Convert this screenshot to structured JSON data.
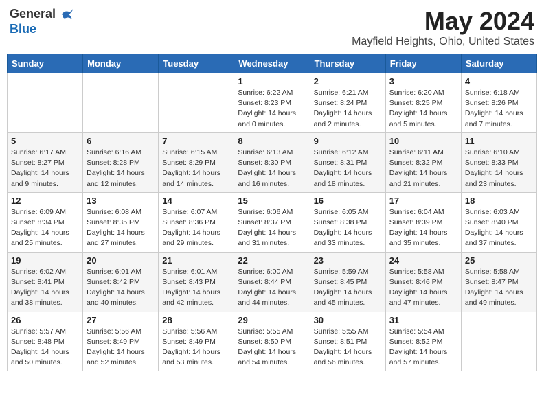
{
  "header": {
    "logo_line1": "General",
    "logo_line2": "Blue",
    "main_title": "May 2024",
    "subtitle": "Mayfield Heights, Ohio, United States"
  },
  "calendar": {
    "weekdays": [
      "Sunday",
      "Monday",
      "Tuesday",
      "Wednesday",
      "Thursday",
      "Friday",
      "Saturday"
    ],
    "weeks": [
      [
        {
          "day": "",
          "info": ""
        },
        {
          "day": "",
          "info": ""
        },
        {
          "day": "",
          "info": ""
        },
        {
          "day": "1",
          "info": "Sunrise: 6:22 AM\nSunset: 8:23 PM\nDaylight: 14 hours and 0 minutes."
        },
        {
          "day": "2",
          "info": "Sunrise: 6:21 AM\nSunset: 8:24 PM\nDaylight: 14 hours and 2 minutes."
        },
        {
          "day": "3",
          "info": "Sunrise: 6:20 AM\nSunset: 8:25 PM\nDaylight: 14 hours and 5 minutes."
        },
        {
          "day": "4",
          "info": "Sunrise: 6:18 AM\nSunset: 8:26 PM\nDaylight: 14 hours and 7 minutes."
        }
      ],
      [
        {
          "day": "5",
          "info": "Sunrise: 6:17 AM\nSunset: 8:27 PM\nDaylight: 14 hours and 9 minutes."
        },
        {
          "day": "6",
          "info": "Sunrise: 6:16 AM\nSunset: 8:28 PM\nDaylight: 14 hours and 12 minutes."
        },
        {
          "day": "7",
          "info": "Sunrise: 6:15 AM\nSunset: 8:29 PM\nDaylight: 14 hours and 14 minutes."
        },
        {
          "day": "8",
          "info": "Sunrise: 6:13 AM\nSunset: 8:30 PM\nDaylight: 14 hours and 16 minutes."
        },
        {
          "day": "9",
          "info": "Sunrise: 6:12 AM\nSunset: 8:31 PM\nDaylight: 14 hours and 18 minutes."
        },
        {
          "day": "10",
          "info": "Sunrise: 6:11 AM\nSunset: 8:32 PM\nDaylight: 14 hours and 21 minutes."
        },
        {
          "day": "11",
          "info": "Sunrise: 6:10 AM\nSunset: 8:33 PM\nDaylight: 14 hours and 23 minutes."
        }
      ],
      [
        {
          "day": "12",
          "info": "Sunrise: 6:09 AM\nSunset: 8:34 PM\nDaylight: 14 hours and 25 minutes."
        },
        {
          "day": "13",
          "info": "Sunrise: 6:08 AM\nSunset: 8:35 PM\nDaylight: 14 hours and 27 minutes."
        },
        {
          "day": "14",
          "info": "Sunrise: 6:07 AM\nSunset: 8:36 PM\nDaylight: 14 hours and 29 minutes."
        },
        {
          "day": "15",
          "info": "Sunrise: 6:06 AM\nSunset: 8:37 PM\nDaylight: 14 hours and 31 minutes."
        },
        {
          "day": "16",
          "info": "Sunrise: 6:05 AM\nSunset: 8:38 PM\nDaylight: 14 hours and 33 minutes."
        },
        {
          "day": "17",
          "info": "Sunrise: 6:04 AM\nSunset: 8:39 PM\nDaylight: 14 hours and 35 minutes."
        },
        {
          "day": "18",
          "info": "Sunrise: 6:03 AM\nSunset: 8:40 PM\nDaylight: 14 hours and 37 minutes."
        }
      ],
      [
        {
          "day": "19",
          "info": "Sunrise: 6:02 AM\nSunset: 8:41 PM\nDaylight: 14 hours and 38 minutes."
        },
        {
          "day": "20",
          "info": "Sunrise: 6:01 AM\nSunset: 8:42 PM\nDaylight: 14 hours and 40 minutes."
        },
        {
          "day": "21",
          "info": "Sunrise: 6:01 AM\nSunset: 8:43 PM\nDaylight: 14 hours and 42 minutes."
        },
        {
          "day": "22",
          "info": "Sunrise: 6:00 AM\nSunset: 8:44 PM\nDaylight: 14 hours and 44 minutes."
        },
        {
          "day": "23",
          "info": "Sunrise: 5:59 AM\nSunset: 8:45 PM\nDaylight: 14 hours and 45 minutes."
        },
        {
          "day": "24",
          "info": "Sunrise: 5:58 AM\nSunset: 8:46 PM\nDaylight: 14 hours and 47 minutes."
        },
        {
          "day": "25",
          "info": "Sunrise: 5:58 AM\nSunset: 8:47 PM\nDaylight: 14 hours and 49 minutes."
        }
      ],
      [
        {
          "day": "26",
          "info": "Sunrise: 5:57 AM\nSunset: 8:48 PM\nDaylight: 14 hours and 50 minutes."
        },
        {
          "day": "27",
          "info": "Sunrise: 5:56 AM\nSunset: 8:49 PM\nDaylight: 14 hours and 52 minutes."
        },
        {
          "day": "28",
          "info": "Sunrise: 5:56 AM\nSunset: 8:49 PM\nDaylight: 14 hours and 53 minutes."
        },
        {
          "day": "29",
          "info": "Sunrise: 5:55 AM\nSunset: 8:50 PM\nDaylight: 14 hours and 54 minutes."
        },
        {
          "day": "30",
          "info": "Sunrise: 5:55 AM\nSunset: 8:51 PM\nDaylight: 14 hours and 56 minutes."
        },
        {
          "day": "31",
          "info": "Sunrise: 5:54 AM\nSunset: 8:52 PM\nDaylight: 14 hours and 57 minutes."
        },
        {
          "day": "",
          "info": ""
        }
      ]
    ]
  }
}
